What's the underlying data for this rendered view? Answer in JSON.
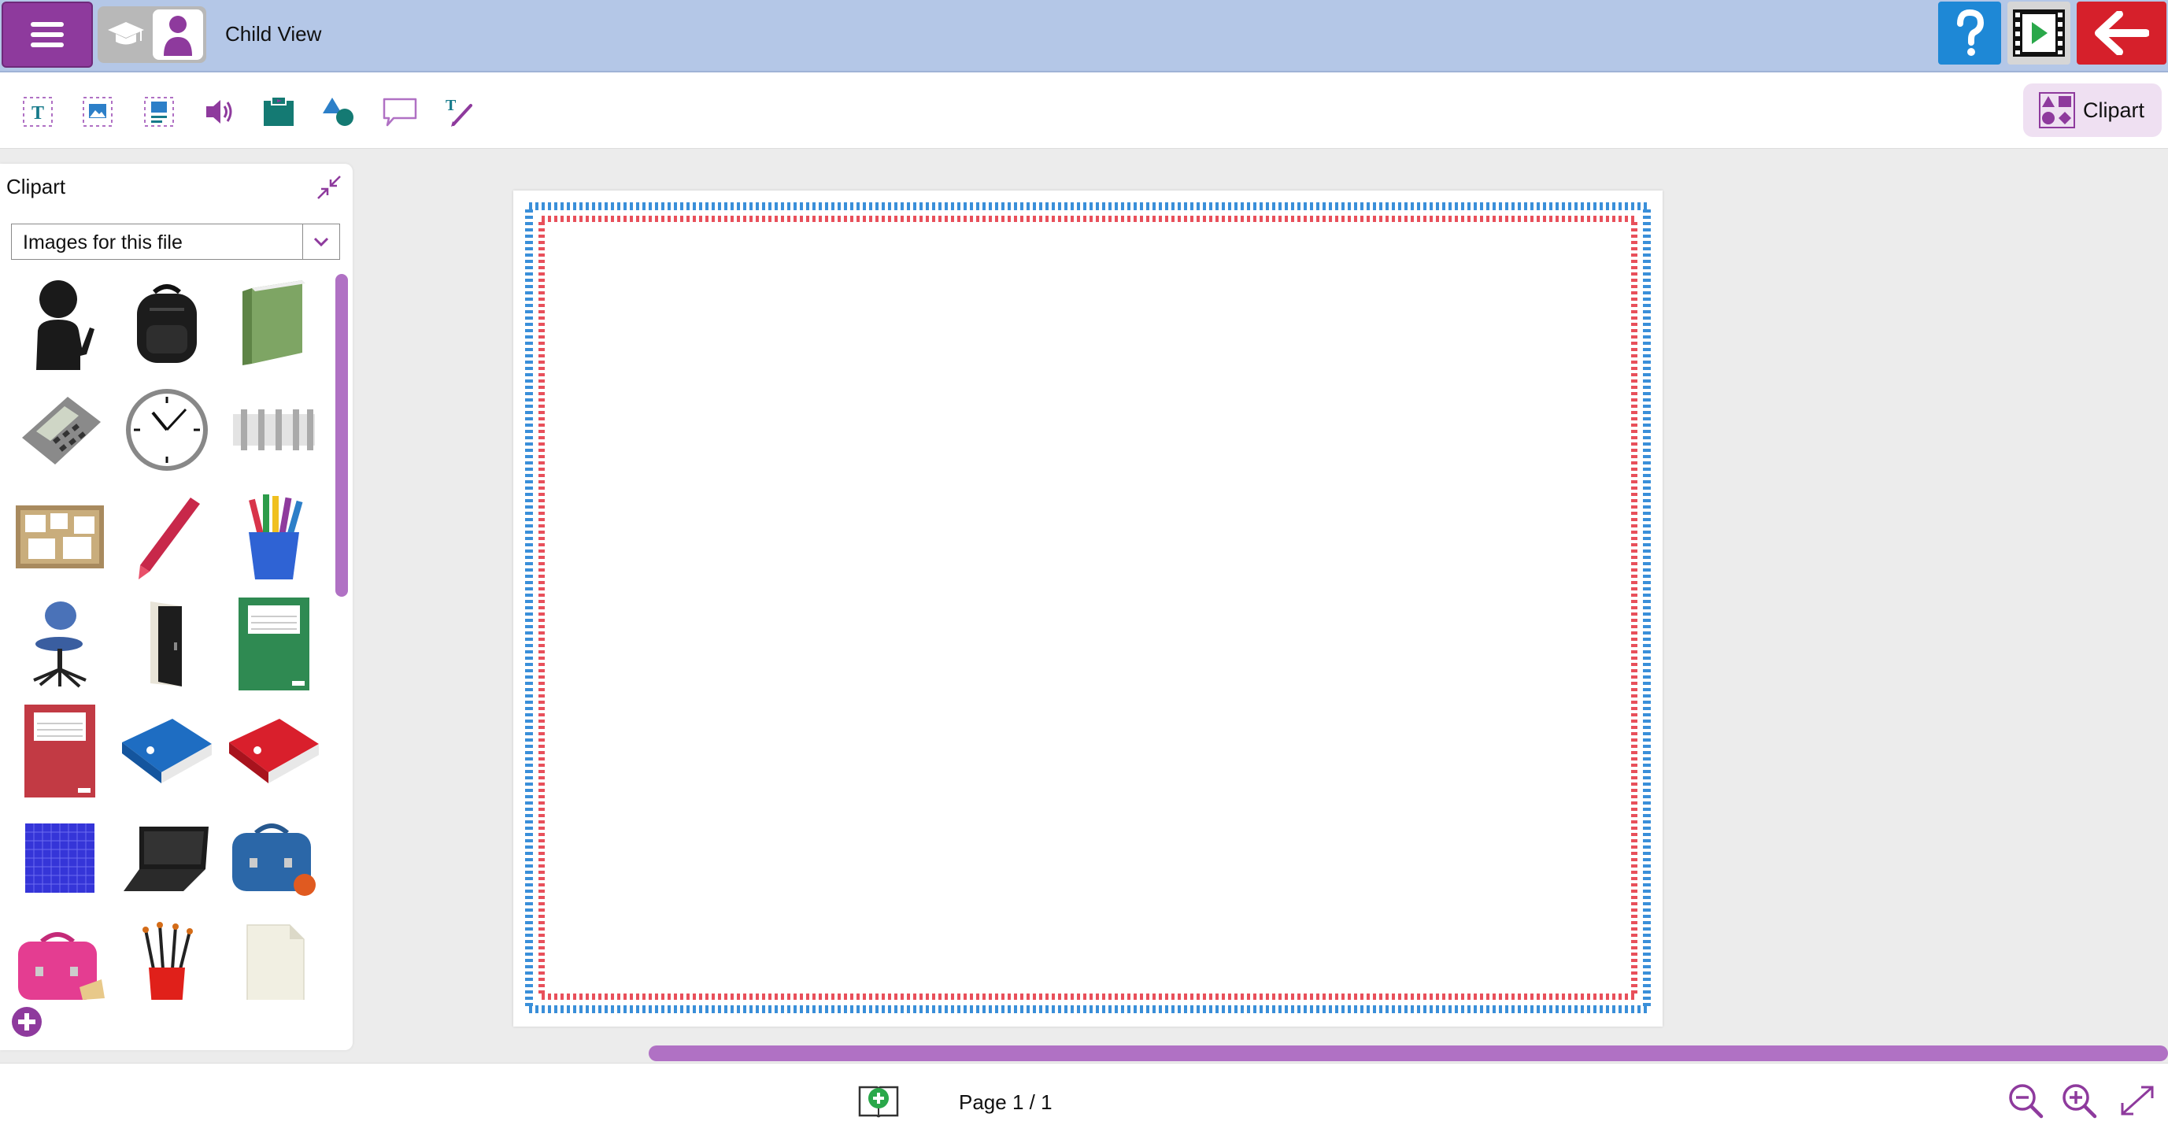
{
  "header": {
    "menu_icon": "hamburger-menu-icon",
    "view_label": "Child View",
    "teacher_icon": "graduation-cap-icon",
    "child_icon": "child-person-icon",
    "help_icon": "question-mark-icon",
    "preview_icon": "film-play-icon",
    "exit_icon": "arrow-left-icon",
    "colors": {
      "bar": "#b4c7e7",
      "menu": "#8e3a9d",
      "help": "#1e88d6",
      "exit": "#d6202b"
    }
  },
  "toolbar": {
    "tools": [
      {
        "icon": "text-box-icon"
      },
      {
        "icon": "image-box-icon"
      },
      {
        "icon": "text-image-box-icon"
      },
      {
        "icon": "speaker-icon"
      },
      {
        "icon": "background-icon"
      },
      {
        "icon": "shapes-icon"
      },
      {
        "icon": "speech-bubble-icon"
      },
      {
        "icon": "pen-text-icon"
      }
    ],
    "clipart_label": "Clipart",
    "clipart_icon": "clipart-shapes-icon"
  },
  "clipart_panel": {
    "title": "Clipart",
    "collapse_icon": "collapse-arrows-icon",
    "source_select": {
      "selected": "Images for this file"
    },
    "items": [
      "child-silhouette-clipart",
      "backpack-clipart",
      "green-book-clipart",
      "calculator-clipart",
      "wall-clock-clipart",
      "abacus-clipart",
      "cork-board-clipart",
      "red-crayon-clipart",
      "crayon-cup-clipart",
      "office-chair-clipart",
      "door-clipart",
      "green-exercise-book-clipart",
      "red-exercise-book-clipart",
      "blue-binder-clipart",
      "red-binder-clipart",
      "grid-paper-clipart",
      "laptop-clipart",
      "blue-lunchbox-clipart",
      "pink-lunchbox-clipart",
      "paintbrushes-clipart",
      "paper-sheet-clipart"
    ],
    "add_icon": "plus-circle-icon",
    "accent": "#b071c4"
  },
  "canvas": {
    "border_outer": "#3a8fd9",
    "border_inner": "#e8505b"
  },
  "footer": {
    "add_page_icon": "add-page-book-icon",
    "page_indicator": "Page 1 / 1",
    "zoom_out_icon": "zoom-out-icon",
    "zoom_in_icon": "zoom-in-icon",
    "fullscreen_icon": "fullscreen-expand-icon"
  }
}
